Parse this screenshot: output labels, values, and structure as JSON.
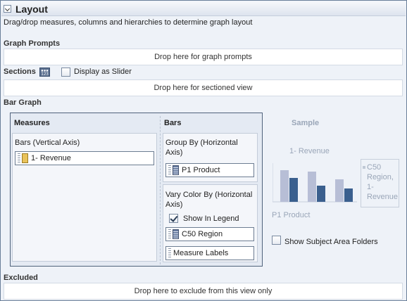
{
  "header": {
    "title": "Layout"
  },
  "instructions": "Drag/drop measures, columns and hierarchies to determine graph layout",
  "graph_prompts": {
    "label": "Graph Prompts",
    "drop_text": "Drop here for graph prompts"
  },
  "sections": {
    "label": "Sections",
    "slider_label": "Display as Slider",
    "slider_checked": false,
    "drop_text": "Drop here for sectioned view"
  },
  "bar_graph": {
    "label": "Bar Graph",
    "measures": {
      "title": "Measures",
      "axis_label": "Bars (Vertical Axis)",
      "items": [
        {
          "label": "1- Revenue",
          "icon": "measure-icon"
        }
      ]
    },
    "bars": {
      "title": "Bars",
      "group_by": {
        "label": "Group By (Horizontal Axis)",
        "items": [
          {
            "label": "P1 Product",
            "icon": "column-icon"
          }
        ]
      },
      "vary_color": {
        "label": "Vary Color By (Horizontal Axis)",
        "show_in_legend_label": "Show In Legend",
        "show_in_legend_checked": true,
        "items": [
          {
            "label": "C50 Region",
            "icon": "column-icon"
          },
          {
            "label": "Measure Labels",
            "icon": "none"
          }
        ]
      }
    }
  },
  "sample": {
    "title": "Sample",
    "y_label": "1- Revenue",
    "x_label": "P1 Product",
    "legend_text": "C50 Region, 1- Revenue",
    "colors": {
      "light": "#b7bed6",
      "dark": "#3a5f8e"
    },
    "bar_pairs": [
      [
        0.82,
        0.62
      ],
      [
        0.78,
        0.42
      ],
      [
        0.58,
        0.34
      ]
    ]
  },
  "show_subject_area_folders": {
    "label": "Show Subject Area Folders",
    "checked": false
  },
  "excluded": {
    "label": "Excluded",
    "drop_text": "Drop here to exclude from this view only"
  }
}
